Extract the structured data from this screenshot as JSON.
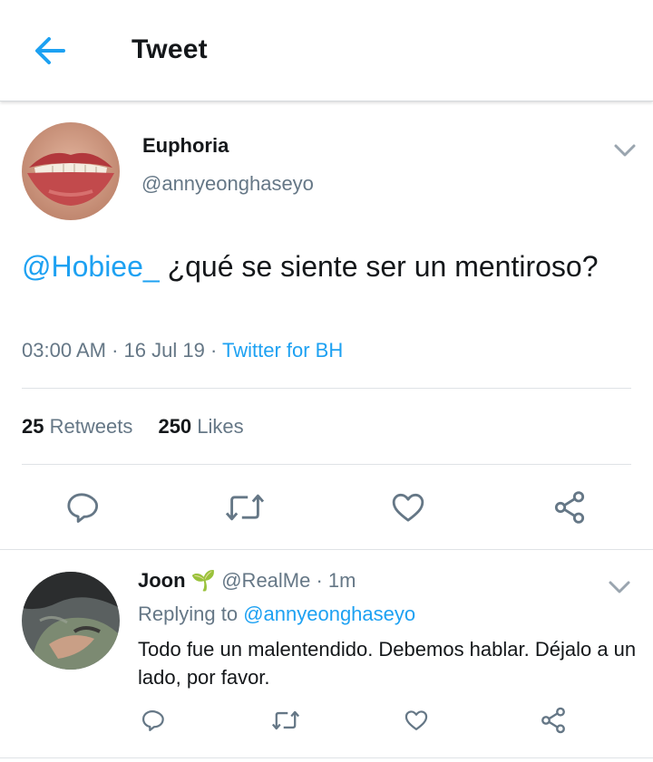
{
  "header": {
    "title": "Tweet",
    "back_icon": "arrow-left-icon"
  },
  "colors": {
    "accent": "#1da1f2",
    "secondary_text": "#657786",
    "primary_text": "#14171a"
  },
  "tweet": {
    "display_name": "Euphoria",
    "handle": "@annyeonghaseyo",
    "mention": "@Hobiee_",
    "text": " ¿qué se siente ser un mentiroso?",
    "time": "03:00 AM",
    "date": "16 Jul 19",
    "source": "Twitter for BH",
    "retweets_count": "25",
    "retweets_label": "Retweets",
    "likes_count": "250",
    "likes_label": "Likes"
  },
  "reply": {
    "display_name": "Joon",
    "emoji": "🌱",
    "handle": "@RealMe",
    "time_ago": "1m",
    "replying_label": "Replying to",
    "replying_to": "@annyeonghaseyo",
    "text": "Todo fue un malentendido. Debemos hablar. Déjalo a un lado, por favor."
  },
  "actions": [
    "reply-icon",
    "retweet-icon",
    "like-icon",
    "share-icon"
  ]
}
